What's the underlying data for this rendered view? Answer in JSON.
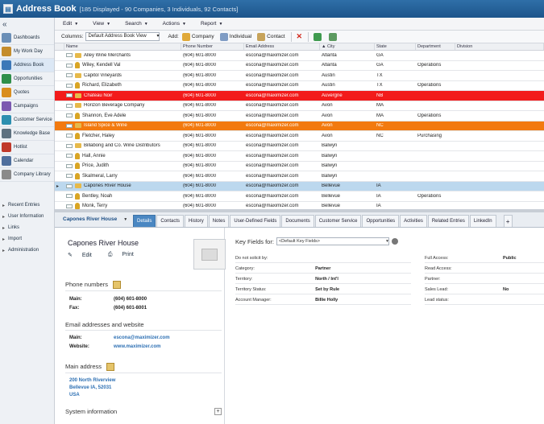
{
  "titlebar": {
    "title": "Address Book",
    "subtitle": "[185 Displayed - 90 Companies, 3 Individuals, 92 Contacts]"
  },
  "menu": [
    {
      "label": "Edit"
    },
    {
      "label": "View"
    },
    {
      "label": "Search"
    },
    {
      "label": "Actions"
    },
    {
      "label": "Report"
    }
  ],
  "toolbar": {
    "columns_label": "Columns:",
    "columns_value": "Default Address Book View",
    "add_label": "Add:",
    "company_label": "Company",
    "individual_label": "Individual",
    "contact_label": "Contact"
  },
  "sidebar": {
    "collapse": "«",
    "items": [
      {
        "label": "Dashboards",
        "color": "#6b8fb7"
      },
      {
        "label": "My Work Day",
        "color": "#c48c2b"
      },
      {
        "label": "Address Book",
        "color": "#3c78b8"
      },
      {
        "label": "Opportunities",
        "color": "#2f8f4a"
      },
      {
        "label": "Quotes",
        "color": "#d98d1e"
      },
      {
        "label": "Campaigns",
        "color": "#7b59b0"
      },
      {
        "label": "Customer Service",
        "color": "#2c8fb0"
      },
      {
        "label": "Knowledge Base",
        "color": "#5e7180"
      },
      {
        "label": "Hotlist",
        "color": "#c0392b"
      },
      {
        "label": "Calendar",
        "color": "#4f6f9d"
      },
      {
        "label": "Company Library",
        "color": "#8a8a8a"
      }
    ],
    "sub": [
      {
        "label": "Recent Entries"
      },
      {
        "label": "User Information"
      },
      {
        "label": "Links"
      },
      {
        "label": "Import"
      },
      {
        "label": "Administration"
      }
    ]
  },
  "grid": {
    "columns": [
      "Name",
      "Phone Number",
      "Email Address",
      "▲ City",
      "State",
      "Department",
      "Division"
    ],
    "rows": [
      {
        "name": "Alley Wine Merchants",
        "phone": "(604) 601-8000",
        "email": "escona@maximizer.com",
        "city": "Atlanta",
        "state": "GA",
        "dept": "",
        "kind": "folder",
        "style": ""
      },
      {
        "name": "Wiley, Kendell Val",
        "phone": "(604) 601-8000",
        "email": "escona@maximizer.com",
        "city": "Atlanta",
        "state": "GA",
        "dept": "Operations",
        "kind": "person",
        "style": ""
      },
      {
        "name": "Capitol Vineyards",
        "phone": "(604) 601-8000",
        "email": "escona@maximizer.com",
        "city": "Austin",
        "state": "TX",
        "dept": "",
        "kind": "folder",
        "style": ""
      },
      {
        "name": "Richard, Elizabeth",
        "phone": "(604) 601-8000",
        "email": "escona@maximizer.com",
        "city": "Austin",
        "state": "TX",
        "dept": "Operations",
        "kind": "person",
        "style": ""
      },
      {
        "name": "Chateau Noir",
        "phone": "(604) 601-8000",
        "email": "escona@maximizer.com",
        "city": "Auvergne",
        "state": "NB",
        "dept": "",
        "kind": "folder",
        "style": "red"
      },
      {
        "name": "Horizon Beverage Company",
        "phone": "(604) 601-8000",
        "email": "escona@maximizer.com",
        "city": "Avon",
        "state": "MA",
        "dept": "",
        "kind": "folder",
        "style": ""
      },
      {
        "name": "Shannon, Eve Adele",
        "phone": "(604) 601-8000",
        "email": "escona@maximizer.com",
        "city": "Avon",
        "state": "MA",
        "dept": "Operations",
        "kind": "person",
        "style": ""
      },
      {
        "name": "Island Spice & Wine",
        "phone": "(604) 601-8000",
        "email": "escona@maximizer.com",
        "city": "Avon",
        "state": "NC",
        "dept": "",
        "kind": "folder",
        "style": "orange"
      },
      {
        "name": "Fletcher, Haley",
        "phone": "(604) 601-8000",
        "email": "escona@maximizer.com",
        "city": "Avon",
        "state": "NC",
        "dept": "Purchasing",
        "kind": "person",
        "style": ""
      },
      {
        "name": "Billabong and Co. Wine Distributors",
        "phone": "(604) 601-8000",
        "email": "escona@maximizer.com",
        "city": "Balwyn",
        "state": "",
        "dept": "",
        "kind": "folder",
        "style": ""
      },
      {
        "name": "Hall, Annie",
        "phone": "(604) 601-8000",
        "email": "escona@maximizer.com",
        "city": "Balwyn",
        "state": "",
        "dept": "",
        "kind": "person",
        "style": ""
      },
      {
        "name": "Price, Judith",
        "phone": "(604) 601-8000",
        "email": "escona@maximizer.com",
        "city": "Balwyn",
        "state": "",
        "dept": "",
        "kind": "person",
        "style": ""
      },
      {
        "name": "Skalmeral, Larry",
        "phone": "(604) 601-8000",
        "email": "escona@maximizer.com",
        "city": "Balwyn",
        "state": "",
        "dept": "",
        "kind": "person",
        "style": ""
      },
      {
        "name": "Capones River House",
        "phone": "(604) 601-8000",
        "email": "escona@maximizer.com",
        "city": "Bellevue",
        "state": "IA",
        "dept": "",
        "kind": "folder",
        "style": "blue"
      },
      {
        "name": "Bentley, Noah",
        "phone": "(604) 601-8000",
        "email": "escona@maximizer.com",
        "city": "Bellevue",
        "state": "IA",
        "dept": "Operations",
        "kind": "person",
        "style": ""
      },
      {
        "name": "Monk, Terry",
        "phone": "(604) 601-8000",
        "email": "escona@maximizer.com",
        "city": "Bellevue",
        "state": "IA",
        "dept": "",
        "kind": "person",
        "style": ""
      }
    ]
  },
  "tabs": {
    "record": "Capones River House",
    "items": [
      "Details",
      "Contacts",
      "History",
      "Notes",
      "User-Defined Fields",
      "Documents",
      "Customer Service",
      "Opportunities",
      "Activities",
      "Related Entries",
      "LinkedIn"
    ],
    "plus": "+"
  },
  "detail": {
    "name": "Capones River House",
    "edit": "Edit",
    "print": "Print",
    "phone_section": "Phone numbers",
    "main_label": "Main:",
    "main_value": "(604) 601-8000",
    "fax_label": "Fax:",
    "fax_value": "(604) 601-8001",
    "email_section": "Email addresses and website",
    "email_label": "Main:",
    "email_value": "escona@maximizer.com",
    "web_label": "Website:",
    "web_value": "www.maximizer.com",
    "address_section": "Main address",
    "addr1": "200 North Riverview",
    "addr2": "Bellevue IA, 52031",
    "addr3": "USA",
    "system_section": "System information",
    "system_plus": "+"
  },
  "keyfields": {
    "label": "Key Fields for:",
    "select": "<Default Key Fields>",
    "left": [
      {
        "k": "Do not solicit by:",
        "v": ""
      },
      {
        "k": "Category:",
        "v": "Partner"
      },
      {
        "k": "Territory:",
        "v": "North / Int'l"
      },
      {
        "k": "Territory Status:",
        "v": "Set by Rule"
      },
      {
        "k": "Account Manager:",
        "v": "Billie Holly"
      }
    ],
    "right": [
      {
        "k": "Full Access:",
        "v": "Public"
      },
      {
        "k": "Read Access:",
        "v": ""
      },
      {
        "k": "Partner:",
        "v": ""
      },
      {
        "k": "Sales Lead:",
        "v": "No"
      },
      {
        "k": "Lead status:",
        "v": ""
      }
    ]
  }
}
